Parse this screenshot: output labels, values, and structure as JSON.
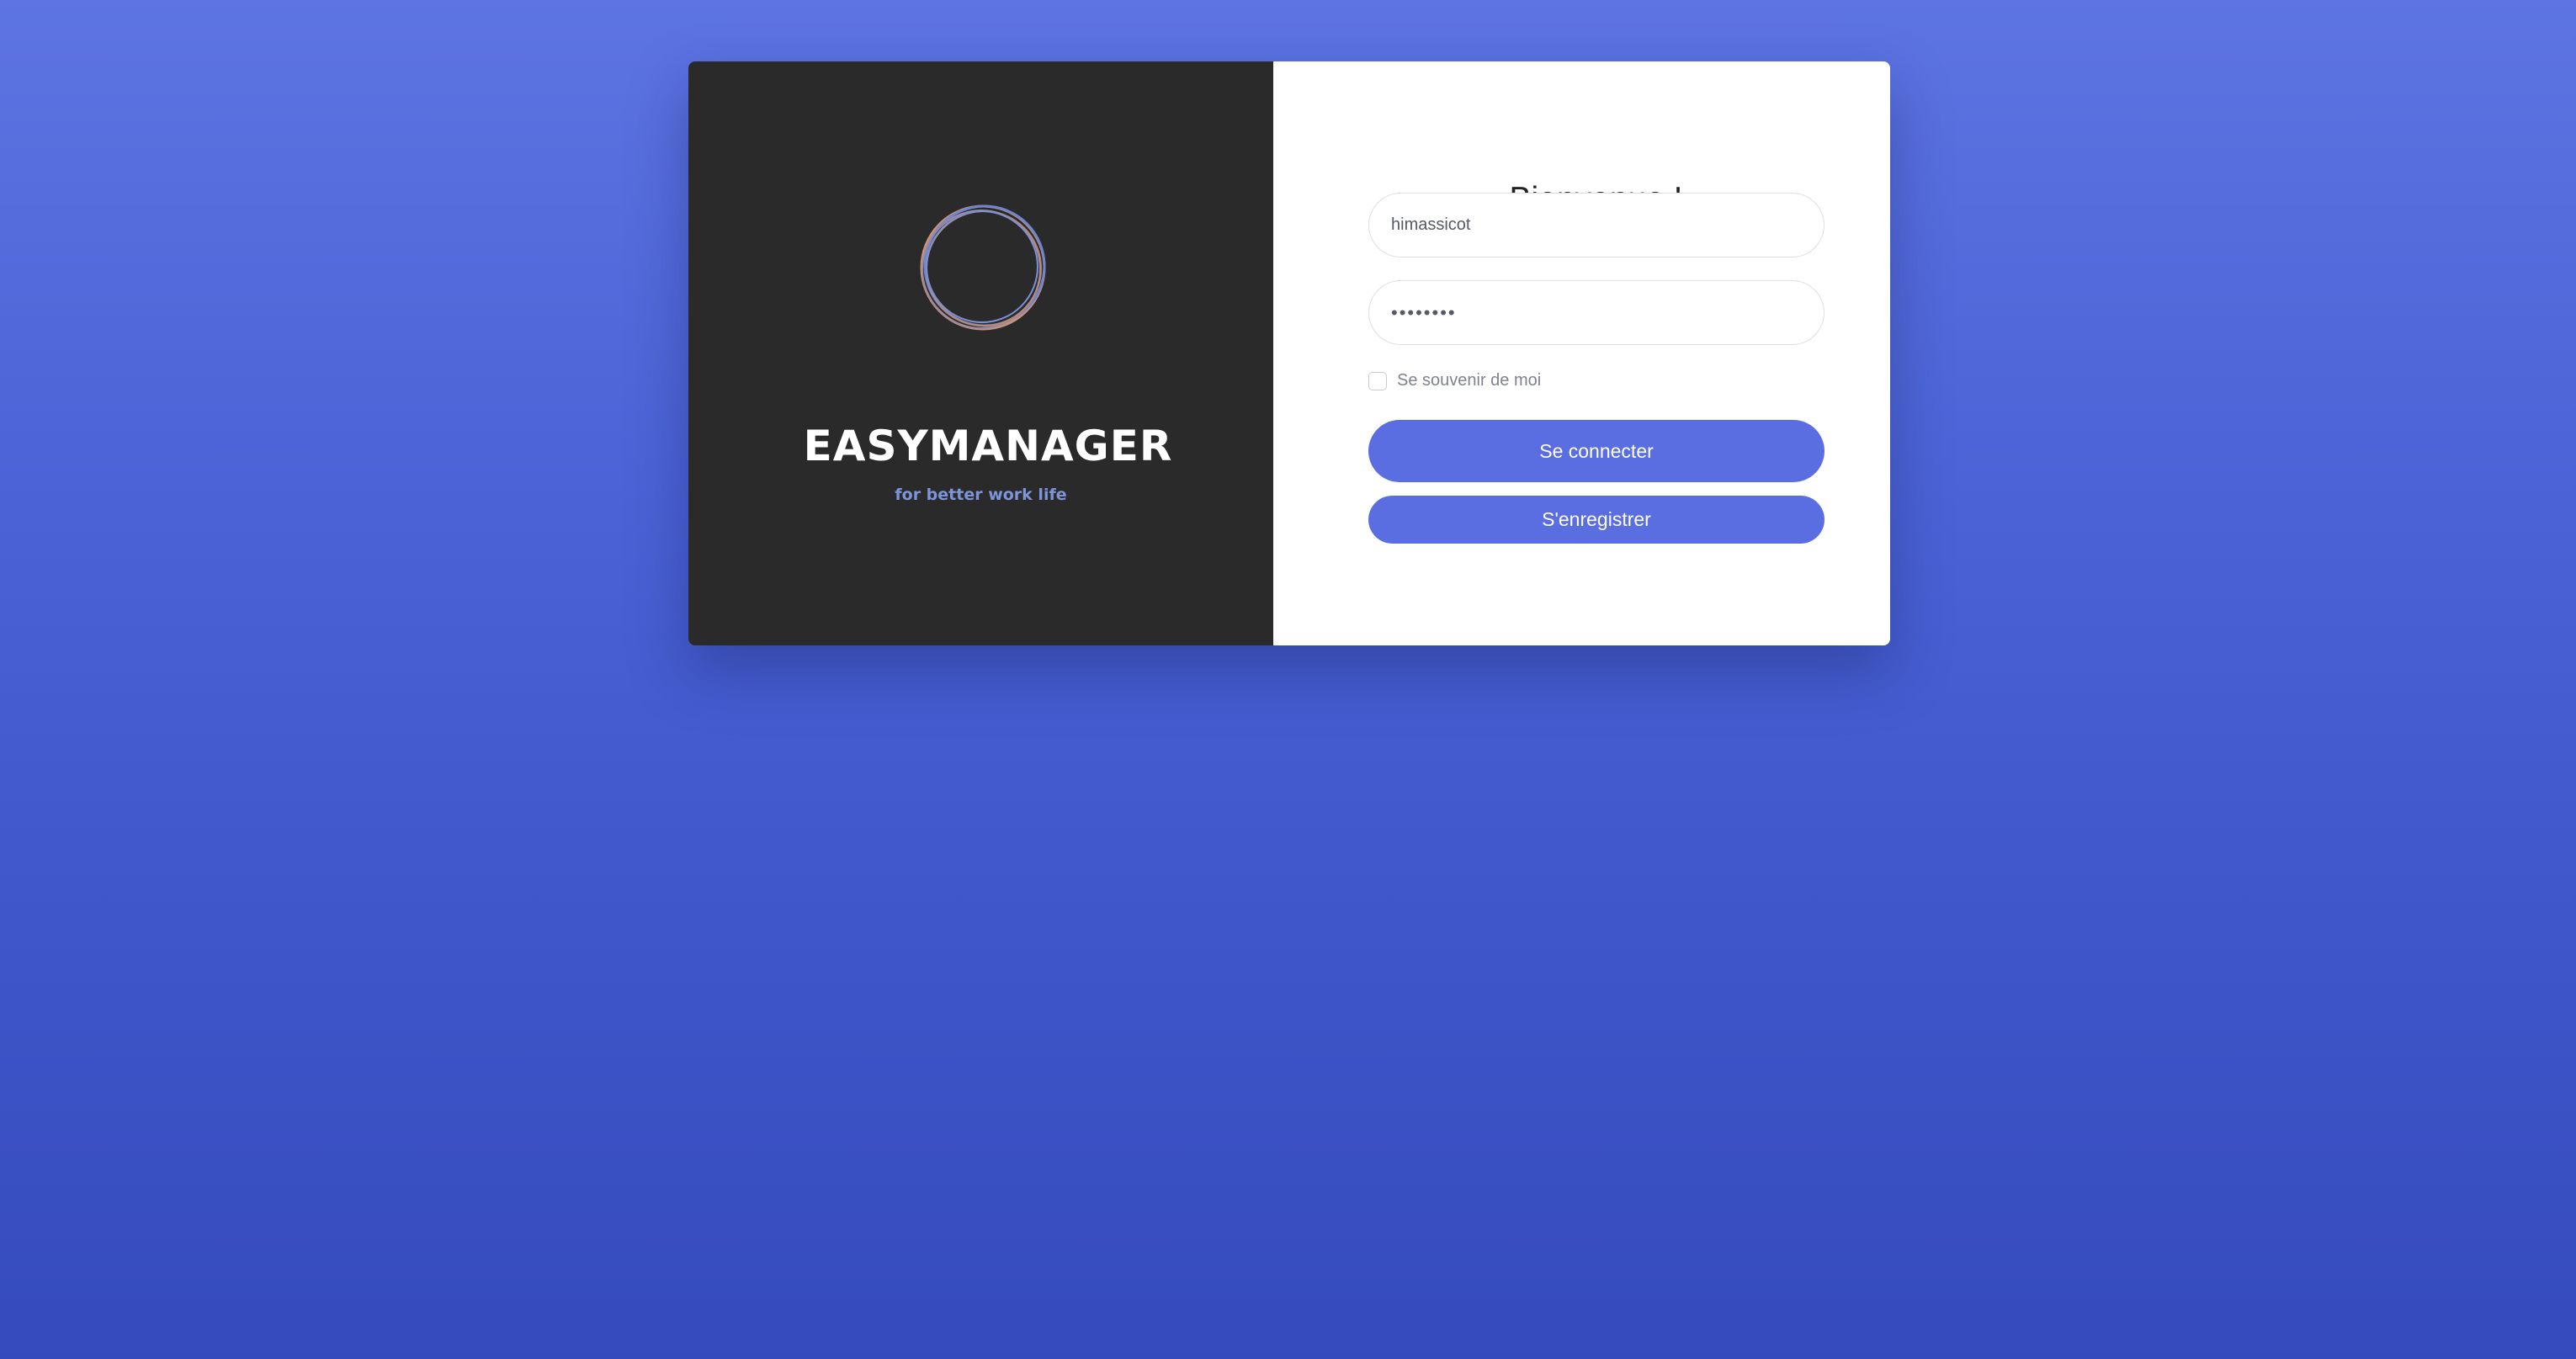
{
  "brand": {
    "name": "EASYMANAGER",
    "tagline": "for better work life",
    "logo_icon": "circle-ring-logo-icon"
  },
  "login": {
    "title": "Bienvenue !",
    "username_value": "himassicot",
    "password_value": "********",
    "remember_label": "Se souvenir de moi",
    "remember_checked": false,
    "login_button": "Se connecter",
    "register_button": "S'enregistrer"
  },
  "colors": {
    "background_top": "#5d74e2",
    "background_bottom": "#354bbd",
    "brand_panel": "#2a2a2a",
    "tagline": "#7d95d8",
    "button": "#5b6ee1"
  }
}
